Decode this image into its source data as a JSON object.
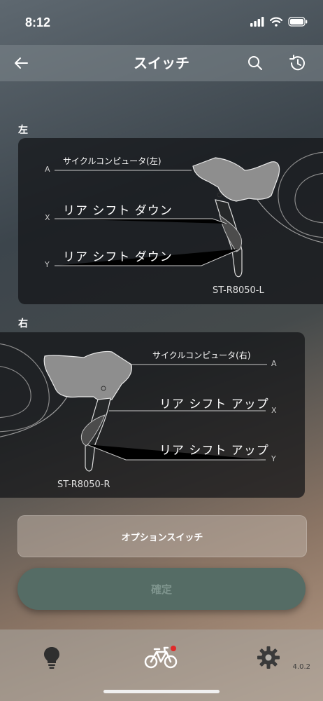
{
  "status_bar": {
    "time": "8:12"
  },
  "header": {
    "title": "スイッチ"
  },
  "left": {
    "section_label": "左",
    "labels": {
      "a_function": "サイクルコンピュータ(左)",
      "x_function": "リア シフト ダウン",
      "y_function": "リア シフト ダウン"
    },
    "axis": {
      "a": "A",
      "x": "X",
      "y": "Y"
    },
    "model": "ST-R8050-L"
  },
  "right": {
    "section_label": "右",
    "labels": {
      "a_function": "サイクルコンピュータ(右)",
      "x_function": "リア シフト アップ",
      "y_function": "リア シフト アップ"
    },
    "axis": {
      "a": "A",
      "x": "X",
      "y": "Y"
    },
    "model": "ST-R8050-R"
  },
  "buttons": {
    "option_switch": "オプションスイッチ",
    "confirm": "確定"
  },
  "tab_bar": {
    "version": "4.0.2",
    "notification_color": "#e02a2a"
  }
}
